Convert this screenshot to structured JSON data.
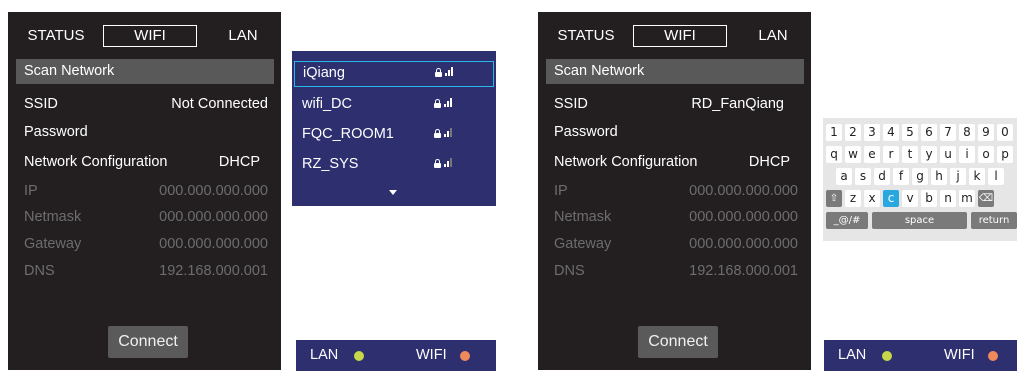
{
  "screens": [
    {
      "tabs": {
        "status": "STATUS",
        "wifi": "WIFI",
        "lan": "LAN"
      },
      "scan_label": "Scan Network",
      "ssid": {
        "label": "SSID",
        "value": "Not Connected"
      },
      "password": {
        "label": "Password"
      },
      "net_config": {
        "label": "Network Configuration",
        "value": "DHCP"
      },
      "ip": {
        "label": "IP",
        "value": "000.000.000.000"
      },
      "netmask": {
        "label": "Netmask",
        "value": "000.000.000.000"
      },
      "gateway": {
        "label": "Gateway",
        "value": "000.000.000.000"
      },
      "dns": {
        "label": "DNS",
        "value": "192.168.000.001"
      },
      "connect_label": "Connect"
    },
    {
      "tabs": {
        "status": "STATUS",
        "wifi": "WIFI",
        "lan": "LAN"
      },
      "scan_label": "Scan Network",
      "ssid": {
        "label": "SSID",
        "value": "RD_FanQiang"
      },
      "password": {
        "label": "Password"
      },
      "net_config": {
        "label": "Network Configuration",
        "value": "DHCP"
      },
      "ip": {
        "label": "IP",
        "value": "000.000.000.000"
      },
      "netmask": {
        "label": "Netmask",
        "value": "000.000.000.000"
      },
      "gateway": {
        "label": "Gateway",
        "value": "000.000.000.000"
      },
      "dns": {
        "label": "DNS",
        "value": "192.168.000.001"
      },
      "connect_label": "Connect"
    }
  ],
  "networks": [
    {
      "name": "iQiang",
      "secured": true,
      "signal_bars": 3,
      "selected": true
    },
    {
      "name": "wifi_DC",
      "secured": true,
      "signal_bars": 3,
      "selected": false
    },
    {
      "name": "FQC_ROOM1",
      "secured": true,
      "signal_bars": 2,
      "selected": false
    },
    {
      "name": "RZ_SYS",
      "secured": true,
      "signal_bars": 2,
      "selected": false
    }
  ],
  "status_bars": [
    {
      "lan": "LAN",
      "wifi": "WIFI"
    },
    {
      "lan": "LAN",
      "wifi": "WIFI"
    }
  ],
  "colors": {
    "lan_dot": "#c8d64a",
    "wifi_dot": "#f08a5d",
    "accent": "#29b6ea",
    "dropdown_bg": "#2d2f6f"
  },
  "keyboard": {
    "row1": [
      "1",
      "2",
      "3",
      "4",
      "5",
      "6",
      "7",
      "8",
      "9",
      "0"
    ],
    "row2": [
      "q",
      "w",
      "e",
      "r",
      "t",
      "y",
      "u",
      "i",
      "o",
      "p"
    ],
    "row3": [
      "a",
      "s",
      "d",
      "f",
      "g",
      "h",
      "j",
      "k",
      "l"
    ],
    "row4": [
      "⇧",
      "z",
      "x",
      "c",
      "v",
      "b",
      "n",
      "m",
      "⌫"
    ],
    "row5": [
      "_@/#",
      "space",
      "return"
    ],
    "highlighted": "c"
  }
}
